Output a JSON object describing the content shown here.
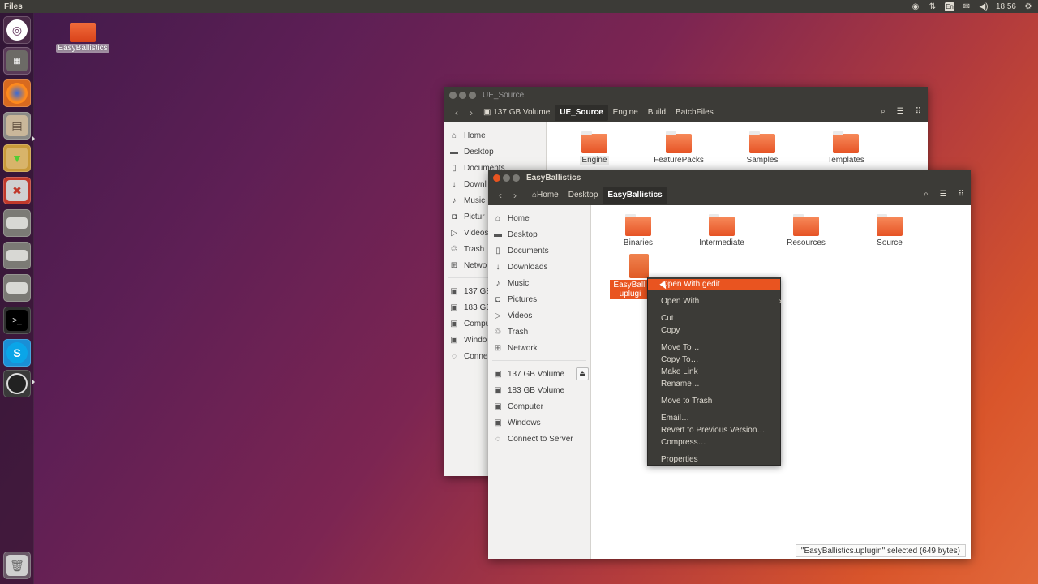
{
  "panel": {
    "app_title": "Files",
    "lang": "En",
    "clock": "18:56"
  },
  "desktop": {
    "icon_label": "EasyBallistics"
  },
  "back_window": {
    "title": "UE_Source",
    "breadcrumbs": [
      "137 GB Volume",
      "UE_Source",
      "Engine",
      "Build",
      "BatchFiles"
    ],
    "sidebar": [
      "Home",
      "Desktop",
      "Documents",
      "Downl",
      "Music",
      "Pictur",
      "Videos",
      "Trash",
      "Netwo",
      "137 GE",
      "183 GE",
      "Compu",
      "Windo",
      "Conne"
    ],
    "files": [
      "Engine",
      "FeaturePacks",
      "Samples",
      "Templates"
    ]
  },
  "front_window": {
    "title": "EasyBallistics",
    "breadcrumbs": [
      "Home",
      "Desktop",
      "EasyBallistics"
    ],
    "sidebar_places": [
      "Home",
      "Desktop",
      "Documents",
      "Downloads",
      "Music",
      "Pictures",
      "Videos",
      "Trash",
      "Network"
    ],
    "sidebar_devices": [
      "137 GB Volume",
      "183 GB Volume",
      "Computer",
      "Windows",
      "Connect to Server"
    ],
    "files": [
      "Binaries",
      "Intermediate",
      "Resources",
      "Source"
    ],
    "selected_file": {
      "line1": "EasyBalli",
      "line2": "uplugi"
    },
    "status": "\"EasyBallistics.uplugin\" selected  (649 bytes)"
  },
  "context_menu": {
    "items": [
      "Open With gedit",
      "Open With",
      "Cut",
      "Copy",
      "Move To…",
      "Copy To…",
      "Make Link",
      "Rename…",
      "Move to Trash",
      "Email…",
      "Revert to Previous Version…",
      "Compress…",
      "Properties"
    ]
  }
}
